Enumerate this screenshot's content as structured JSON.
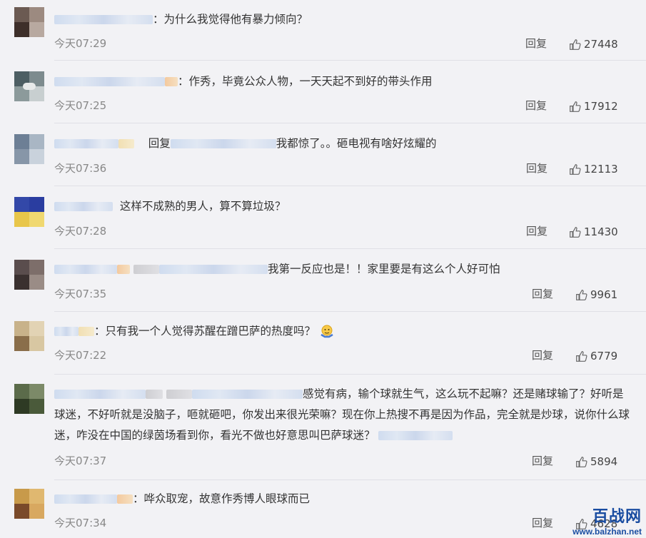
{
  "reply_label": "回复",
  "comments": [
    {
      "text": "：为什么我觉得他有暴力倾向？",
      "time": "今天07:29",
      "likes": "27448"
    },
    {
      "text": "：作秀，毕竟公众人物，一天天起不到好的带头作用",
      "time": "今天07:25",
      "likes": "17912"
    },
    {
      "reply_prefix": "回复",
      "text": "我都惊了。。砸电视有啥好炫耀的",
      "time": "今天07:36",
      "likes": "12113"
    },
    {
      "text": "这样不成熟的男人，算不算垃圾？",
      "time": "今天07:28",
      "likes": "11430"
    },
    {
      "text": "我第一反应也是！！家里要是有这么个人好可怕",
      "time": "今天07:35",
      "likes": "9961"
    },
    {
      "text": "：只有我一个人觉得苏醒在蹭巴萨的热度吗？",
      "time": "今天07:22",
      "likes": "6779"
    },
    {
      "text": "感觉有病，输个球就生气，这么玩不起嘛？还是赌球输了？好听是球迷，不好听就是没脑子，咂就砸吧，你发出来很光荣嘛？现在你上热搜不再是因为作品，完全就是炒球，说你什么球迷，咋没在中国的绿茵场看到你，看光不做也好意思叫巴萨球迷？",
      "time": "今天07:37",
      "likes": "5894"
    },
    {
      "text": "：哗众取宠，故意作秀博人眼球而已",
      "time": "今天07:34",
      "likes": "4628"
    }
  ],
  "watermark": {
    "logo": "百战网",
    "url": "www.balzhan.net"
  }
}
